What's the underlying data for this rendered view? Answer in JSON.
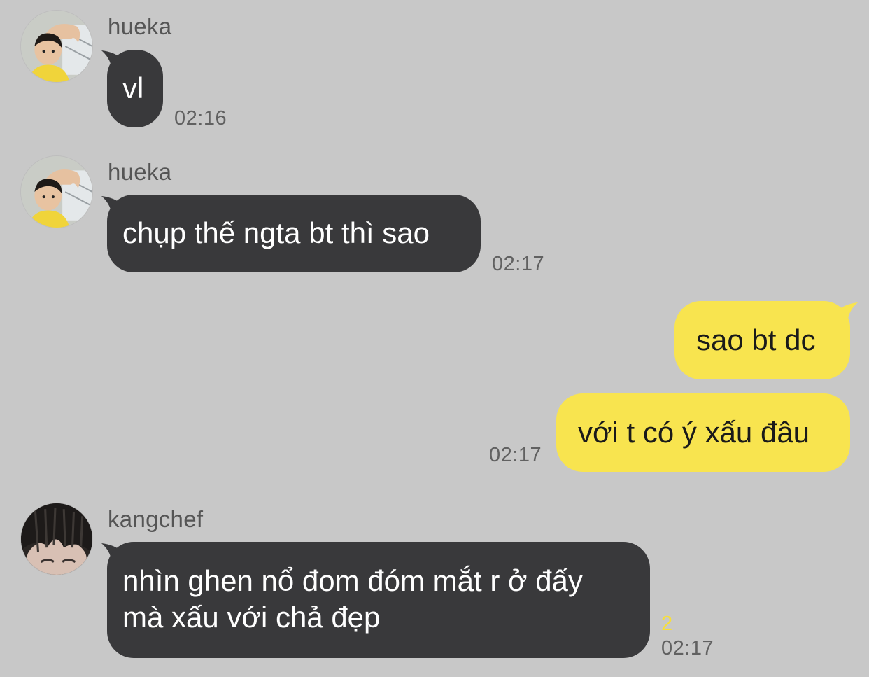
{
  "colors": {
    "background": "#c8c8c8",
    "incoming_bubble": "#39393b",
    "outgoing_bubble": "#f8e44f",
    "unread_count": "#f7df3a",
    "timestamp": "#616161"
  },
  "messages": [
    {
      "sender": "hueka",
      "direction": "incoming",
      "text": "vl",
      "time": "02:16",
      "avatar_icon": "hueka-avatar-photo"
    },
    {
      "sender": "hueka",
      "direction": "incoming",
      "text": "chụp thế ngta bt thì sao",
      "time": "02:17",
      "avatar_icon": "hueka-avatar-photo"
    },
    {
      "direction": "outgoing",
      "text": "sao bt dc"
    },
    {
      "direction": "outgoing",
      "text": "với t có ý xấu đâu",
      "time": "02:17"
    },
    {
      "sender": "kangchef",
      "direction": "incoming",
      "text_line1": "nhìn ghen nổ đom đóm mắt r ở đấy",
      "text_line2": "mà xấu với chả đẹp",
      "time": "02:17",
      "unread": "2",
      "avatar_icon": "kangchef-avatar-photo"
    }
  ]
}
